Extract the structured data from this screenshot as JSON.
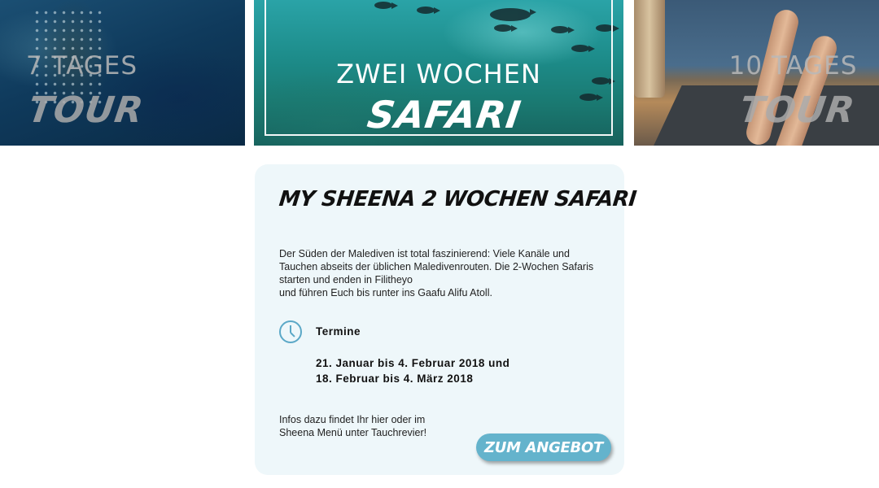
{
  "tiles": {
    "left": {
      "line1": "7 TAGES",
      "line2": "TOUR"
    },
    "middle": {
      "line1": "ZWEI WOCHEN",
      "line2": "SAFARI"
    },
    "right": {
      "line1": "10 TAGES",
      "line2": "TOUR"
    }
  },
  "card": {
    "title": "MY SHEENA 2 WOCHEN SAFARI",
    "description": [
      "Der Süden der Malediven ist total faszinierend: Viele Kanäle und",
      "Tauchen abseits der üblichen Malediven­routen. Die 2-Wochen Safaris",
      "starten und enden in Filitheyo",
      "und führen Euch bis runter ins Gaafu Alifu Atoll."
    ],
    "termine": {
      "icon": "clock-icon",
      "label": "Termine",
      "dates": [
        "21. Januar bis 4. Februar 2018 und",
        "18. Februar bis 4. März 2018"
      ]
    },
    "info": [
      "Infos dazu findet Ihr hier oder im",
      "Sheena Menü unter Tauchrevier!"
    ],
    "cta_label": "ZUM ANGEBOT"
  },
  "colors": {
    "accent": "#64b3cc",
    "card_background": "#eef7fa",
    "clock_icon": "#5ba8c7"
  }
}
